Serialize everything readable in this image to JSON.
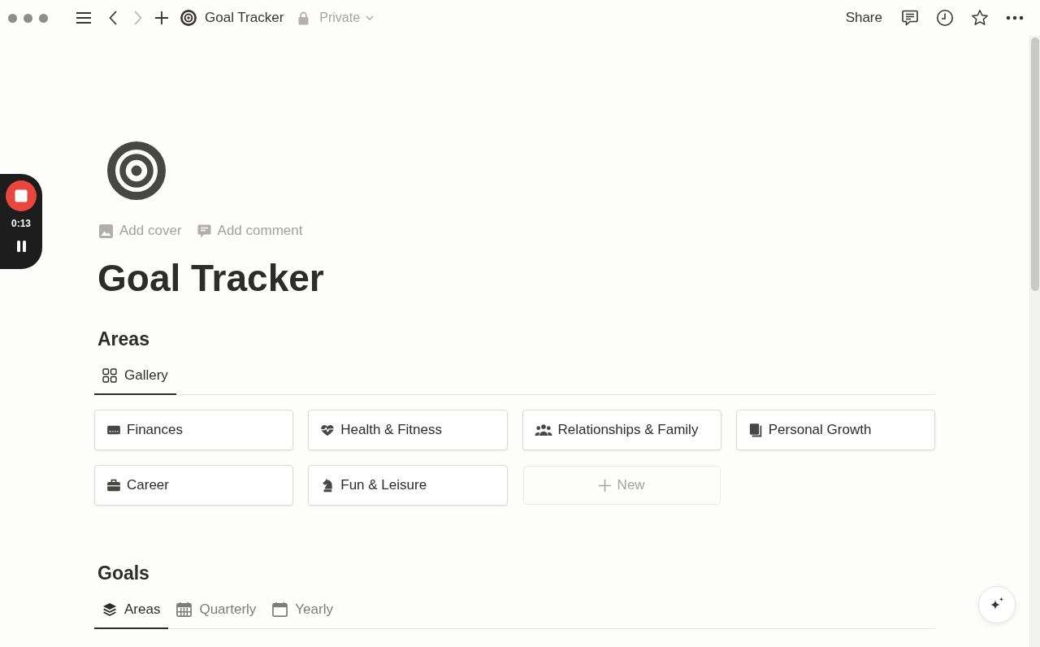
{
  "topbar": {
    "back": {
      "disabled": false
    },
    "forward": {
      "disabled": true
    },
    "page": "Goal Tracker",
    "privacy": "Private",
    "share": "Share"
  },
  "recorder": {
    "time": "0:13"
  },
  "page": {
    "actions": [
      "Add cover",
      "Add comment"
    ],
    "title": "Goal Tracker"
  },
  "areas": {
    "heading": "Areas",
    "tabs": [
      {
        "label": "Gallery",
        "selected": true
      }
    ],
    "cards": [
      "Finances",
      "Health & Fitness",
      "Relationships & Family",
      "Personal Growth",
      "Career",
      "Fun & Leisure"
    ],
    "new_card": "New"
  },
  "goals": {
    "heading": "Goals",
    "tabs": [
      {
        "label": "Areas",
        "selected": true
      },
      {
        "label": "Quarterly",
        "selected": false
      },
      {
        "label": "Yearly",
        "selected": false
      }
    ]
  }
}
